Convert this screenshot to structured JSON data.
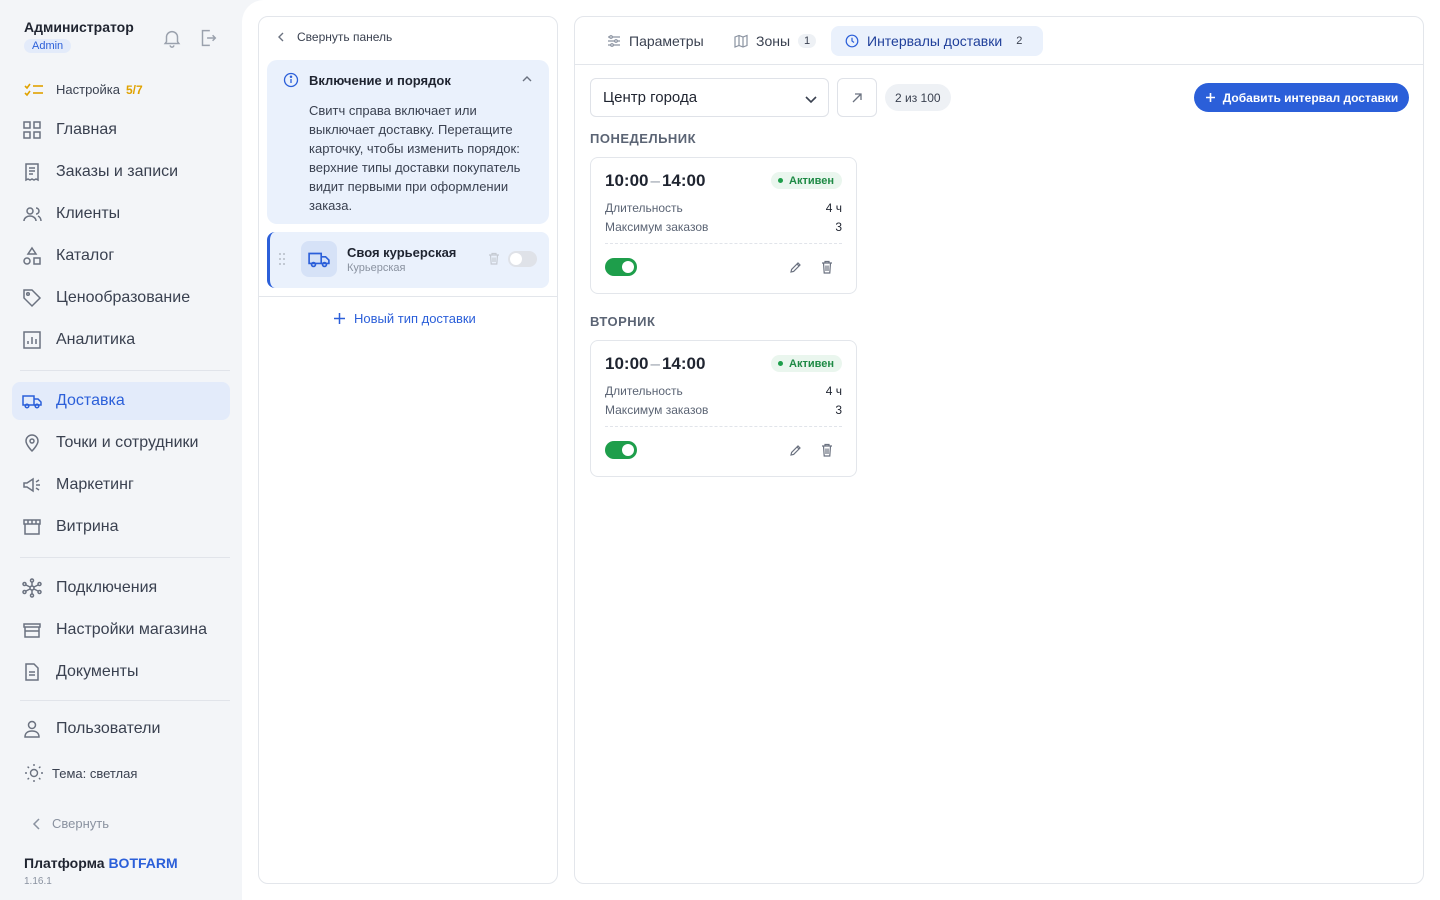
{
  "sidebar": {
    "user_name": "Администратор",
    "user_role": "Admin",
    "setup": {
      "label": "Настройка",
      "progress": "5/7"
    },
    "nav": [
      {
        "label": "Главная",
        "icon": "grid-icon"
      },
      {
        "label": "Заказы и записи",
        "icon": "receipt-icon"
      },
      {
        "label": "Клиенты",
        "icon": "users-icon"
      },
      {
        "label": "Каталог",
        "icon": "shapes-icon"
      },
      {
        "label": "Ценообразование",
        "icon": "tag-icon"
      },
      {
        "label": "Аналитика",
        "icon": "chart-icon"
      },
      {
        "label": "Доставка",
        "icon": "truck-icon",
        "active": true
      },
      {
        "label": "Точки и сотрудники",
        "icon": "location-pin-icon"
      },
      {
        "label": "Маркетинг",
        "icon": "megaphone-icon"
      },
      {
        "label": "Витрина",
        "icon": "storefront-icon"
      },
      {
        "label": "Подключения",
        "icon": "network-icon"
      },
      {
        "label": "Настройки магазина",
        "icon": "store-icon"
      },
      {
        "label": "Документы",
        "icon": "document-icon"
      },
      {
        "label": "Пользователи",
        "icon": "user-icon"
      }
    ],
    "theme_label": "Тема: светлая",
    "collapse_label": "Свернуть",
    "brand_prefix": "Платформа",
    "brand_name": "BOTFARM",
    "version": "1.16.1"
  },
  "panel": {
    "collapse_label": "Свернуть панель",
    "info_title": "Включение и порядок",
    "info_text": "Свитч справа включает или выключает доставку. Перетащите карточку, чтобы изменить порядок: верхние типы доставки покупатель видит первыми при оформлении заказа.",
    "delivery_type": {
      "name": "Своя курьерская",
      "subtitle": "Курьерская",
      "enabled": false
    },
    "new_type_label": "Новый тип доставки"
  },
  "tabs": [
    {
      "label": "Параметры",
      "icon": "sliders-icon",
      "count": ""
    },
    {
      "label": "Зоны",
      "icon": "map-icon",
      "count": "1"
    },
    {
      "label": "Интервалы доставки",
      "icon": "clock-icon",
      "count": "2",
      "active": true
    }
  ],
  "toolbar": {
    "zone_select": "Центр города",
    "count_label": "2 из 100",
    "add_button": "Добавить интервал доставки"
  },
  "days": [
    {
      "name": "ПОНЕДЕЛЬНИК",
      "interval": {
        "start": "10:00",
        "end": "14:00",
        "status": "Активен",
        "duration_label": "Длительность",
        "duration_value": "4 ч",
        "max_orders_label": "Максимум заказов",
        "max_orders_value": "3",
        "enabled": true
      }
    },
    {
      "name": "ВТОРНИК",
      "interval": {
        "start": "10:00",
        "end": "14:00",
        "status": "Активен",
        "duration_label": "Длительность",
        "duration_value": "4 ч",
        "max_orders_label": "Максимум заказов",
        "max_orders_value": "3",
        "enabled": true
      }
    }
  ],
  "colors": {
    "accent": "#2b5fd9",
    "success": "#1e9e4b",
    "setup_progress": "#e0a200"
  }
}
